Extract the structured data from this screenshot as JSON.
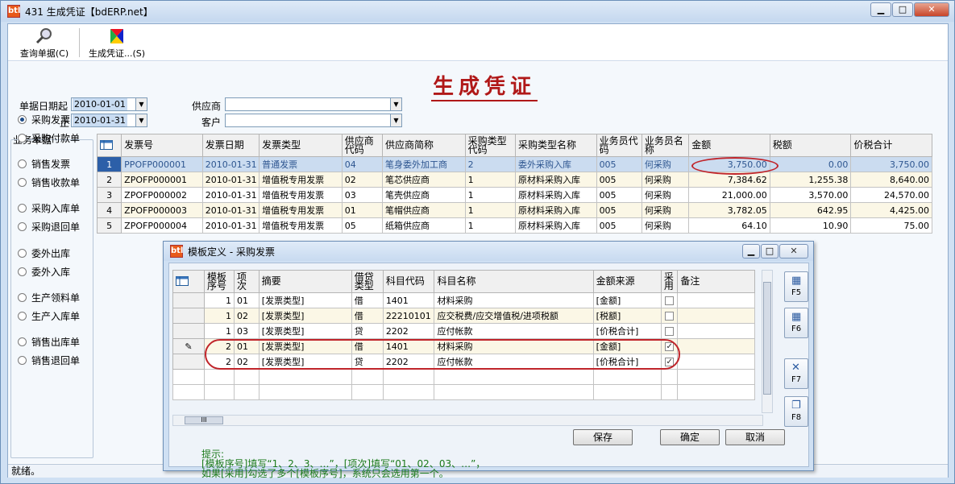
{
  "window": {
    "title": "431 生成凭证【bdERP.net】",
    "app_icon": "bd-erp-icon",
    "min": "▁",
    "max": "□",
    "close": "✕"
  },
  "toolbar": {
    "query_label": "查询单据(C)",
    "generate_label": "生成凭证...(S)"
  },
  "page_title": "生成凭证",
  "filters": {
    "date_from_label": "单据日期起",
    "date_from": "2010-01-01",
    "date_to_label": "止",
    "date_to": "2010-01-31",
    "supplier_label": "供应商",
    "supplier": "",
    "customer_label": "客户",
    "customer": ""
  },
  "nav": {
    "heading": "业务单据",
    "items": [
      "采购发票",
      "采购付款单",
      "销售发票",
      "销售收款单",
      "采购入库单",
      "采购退回单",
      "委外出库",
      "委外入库",
      "生产领料单",
      "生产入库单",
      "销售出库单",
      "销售退回单"
    ],
    "selected": 0
  },
  "invoices": {
    "headers": [
      "发票号",
      "发票日期",
      "发票类型",
      "供应商代码",
      "供应商简称",
      "采购类型代码",
      "采购类型名称",
      "业务员代码",
      "业务员名称",
      "金额",
      "税额",
      "价税合计"
    ],
    "rows": [
      [
        "1",
        "PPOFP000001",
        "2010-01-31",
        "普通发票",
        "04",
        "笔身委外加工商",
        "2",
        "委外采购入库",
        "005",
        "何采购",
        "3,750.00",
        "0.00",
        "3,750.00"
      ],
      [
        "2",
        "ZPOFP000001",
        "2010-01-31",
        "增值税专用发票",
        "02",
        "笔芯供应商",
        "1",
        "原材料采购入库",
        "005",
        "何采购",
        "7,384.62",
        "1,255.38",
        "8,640.00"
      ],
      [
        "3",
        "ZPOFP000002",
        "2010-01-31",
        "增值税专用发票",
        "03",
        "笔壳供应商",
        "1",
        "原材料采购入库",
        "005",
        "何采购",
        "21,000.00",
        "3,570.00",
        "24,570.00"
      ],
      [
        "4",
        "ZPOFP000003",
        "2010-01-31",
        "增值税专用发票",
        "01",
        "笔帽供应商",
        "1",
        "原材料采购入库",
        "005",
        "何采购",
        "3,782.05",
        "642.95",
        "4,425.00"
      ],
      [
        "5",
        "ZPOFP000004",
        "2010-01-31",
        "增值税专用发票",
        "05",
        "纸箱供应商",
        "1",
        "原材料采购入库",
        "005",
        "何采购",
        "64.10",
        "10.90",
        "75.00"
      ]
    ]
  },
  "dialog": {
    "title": "模板定义 - 采购发票",
    "headers": [
      "模板序号",
      "项次",
      "摘要",
      "借贷类型",
      "科目代码",
      "科目名称",
      "金额来源",
      "采用",
      "备注"
    ],
    "rows": [
      {
        "seq": "1",
        "item": "01",
        "summary": "[发票类型]",
        "dc": "借",
        "code": "1401",
        "name": "材料采购",
        "src": "[金额]",
        "use": false,
        "note": ""
      },
      {
        "seq": "1",
        "item": "02",
        "summary": "[发票类型]",
        "dc": "借",
        "code": "22210101",
        "name": "应交税费/应交增值税/进项税额",
        "src": "[税额]",
        "use": false,
        "note": ""
      },
      {
        "seq": "1",
        "item": "03",
        "summary": "[发票类型]",
        "dc": "贷",
        "code": "2202",
        "name": "应付帐款",
        "src": "[价税合计]",
        "use": false,
        "note": ""
      },
      {
        "seq": "2",
        "item": "01",
        "summary": "[发票类型]",
        "dc": "借",
        "code": "1401",
        "name": "材料采购",
        "src": "[金额]",
        "use": true,
        "note": ""
      },
      {
        "seq": "2",
        "item": "02",
        "summary": "[发票类型]",
        "dc": "贷",
        "code": "2202",
        "name": "应付帐款",
        "src": "[价税合计]",
        "use": true,
        "note": ""
      }
    ],
    "side_buttons": [
      "F5",
      "F6",
      "F7",
      "F8"
    ],
    "hint_lines": [
      "提示:",
      "[模板序号]填写“1、2、3、…”，[项次]填写“01、02、03、…”，",
      "如果[采用]勾选了多个[模板序号]，系统只会选用第一个。"
    ],
    "save": "保存",
    "ok": "确定",
    "cancel": "取消"
  },
  "status": "就绪。"
}
